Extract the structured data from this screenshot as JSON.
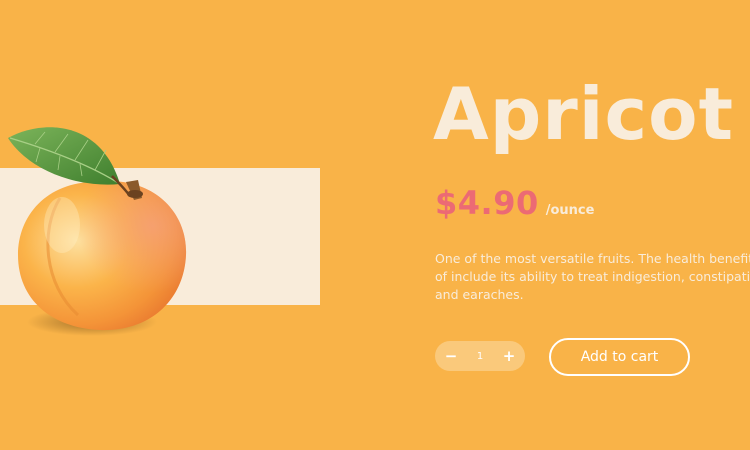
{
  "product": {
    "name": "Apricot",
    "price": "$4.90",
    "unit": "/ounce",
    "description": "One of the most versatile fruits. The health benefits of include its ability to treat indigestion, constipation and earaches."
  },
  "quantity": {
    "minus_icon": "minus-icon",
    "plus_icon": "plus-icon",
    "value": "1"
  },
  "cart": {
    "label": "Add to cart"
  },
  "colors": {
    "background": "#f9b348",
    "cream": "#f9ecda",
    "price": "#ec6a74",
    "white": "#ffffff"
  },
  "image": {
    "icon": "apricot-fruit-image"
  }
}
